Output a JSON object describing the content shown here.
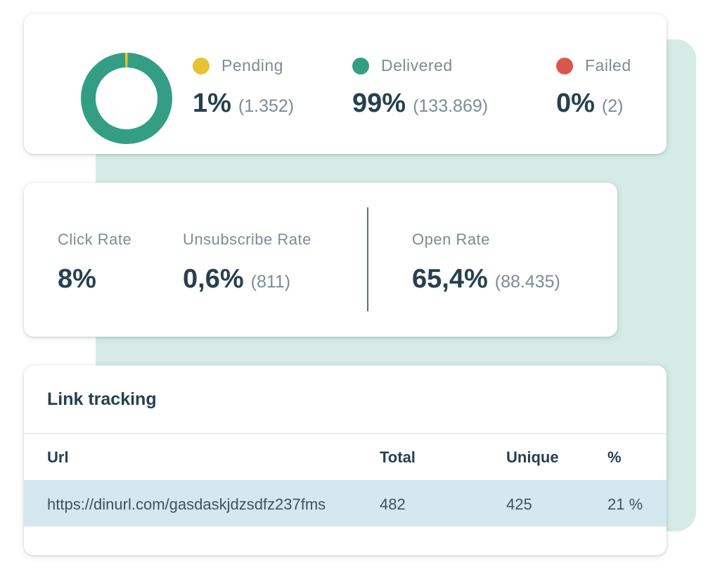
{
  "delivery": {
    "donut": {
      "pending_fraction": 0.01,
      "delivered_fraction": 0.99,
      "failed_fraction": 0.0
    },
    "stats": [
      {
        "label": "Pending",
        "percent": "1%",
        "count": "(1.352)",
        "color": "#e8c334"
      },
      {
        "label": "Delivered",
        "percent": "99%",
        "count": "(133.869)",
        "color": "#339e83"
      },
      {
        "label": "Failed",
        "percent": "0%",
        "count": "(2)",
        "color": "#d9574a"
      }
    ]
  },
  "rates": {
    "click": {
      "label": "Click Rate",
      "value": "8%"
    },
    "unsubscribe": {
      "label": "Unsubscribe Rate",
      "value": "0,6%",
      "count": "(811)"
    },
    "open": {
      "label": "Open Rate",
      "value": "65,4%",
      "count": "(88.435)"
    }
  },
  "link_tracking": {
    "title": "Link tracking",
    "columns": [
      "Url",
      "Total",
      "Unique",
      "%"
    ],
    "rows": [
      {
        "url": "https://dinurl.com/gasdaskjdzsdfz237fms",
        "total": "482",
        "unique": "425",
        "percent": "21 %"
      }
    ]
  },
  "colors": {
    "backdrop": "#d4ece5",
    "text_dark": "#27404f",
    "text_muted": "#7d8b96",
    "row_highlight": "#d3e8ef"
  }
}
